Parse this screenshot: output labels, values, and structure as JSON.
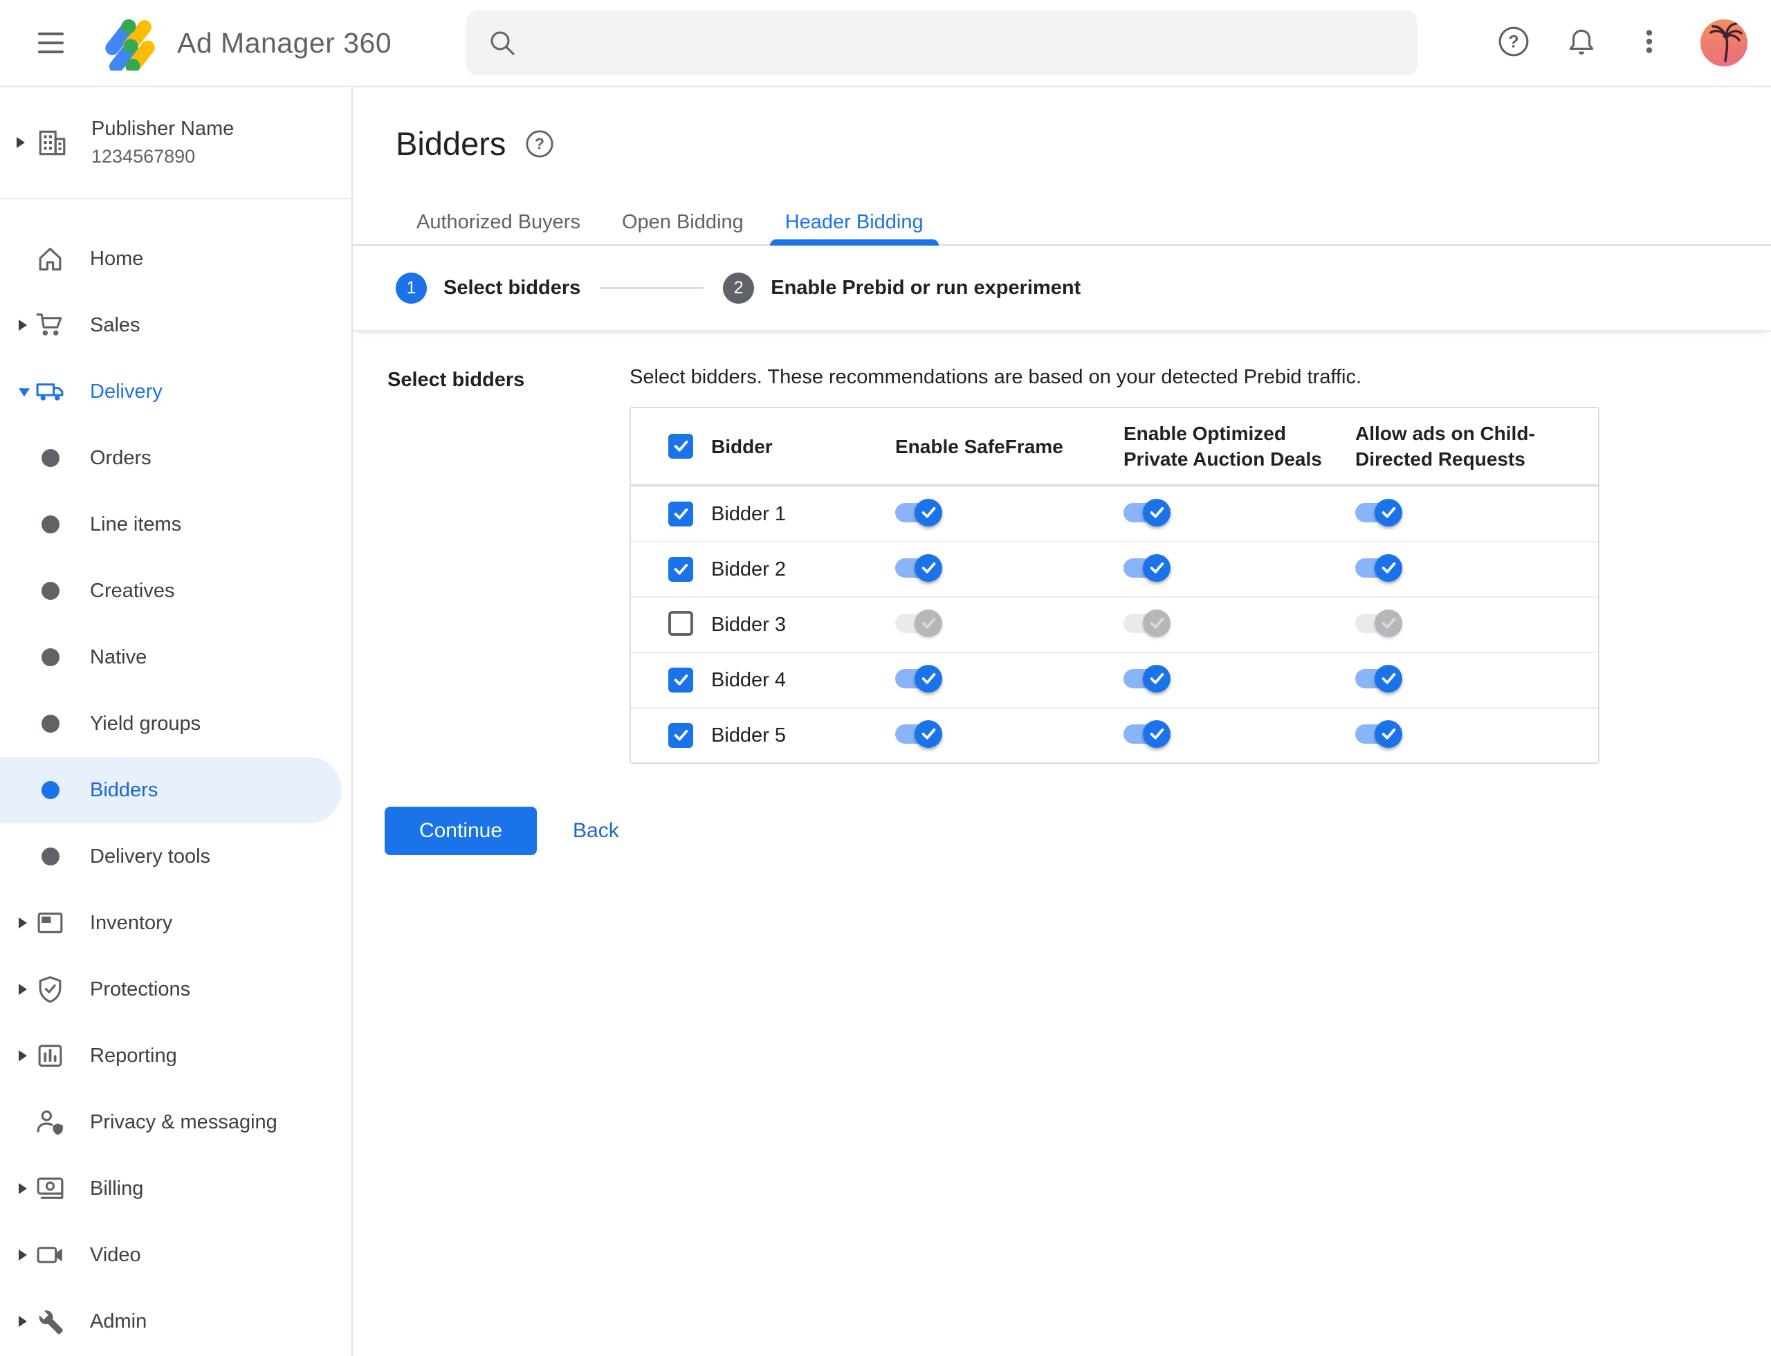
{
  "header": {
    "app_name": "Ad Manager 360",
    "search": {
      "placeholder": ""
    },
    "actions": [
      {
        "name": "help",
        "icon": "help-icon"
      },
      {
        "name": "notifications",
        "icon": "bell-icon"
      },
      {
        "name": "more",
        "icon": "more-vert-icon"
      },
      {
        "name": "account",
        "icon": "palm-avatar"
      }
    ]
  },
  "sidebar": {
    "publisher": {
      "name": "Publisher Name",
      "id": "1234567890"
    },
    "items": [
      {
        "label": "Home",
        "icon": "home",
        "caret": "none",
        "level": 0,
        "state": "normal"
      },
      {
        "label": "Sales",
        "icon": "cart",
        "caret": "right",
        "level": 0,
        "state": "normal"
      },
      {
        "label": "Delivery",
        "icon": "truck",
        "caret": "down",
        "level": 0,
        "state": "expanded"
      },
      {
        "label": "Orders",
        "icon": "bullet",
        "caret": "none",
        "level": 1,
        "state": "normal"
      },
      {
        "label": "Line items",
        "icon": "bullet",
        "caret": "none",
        "level": 1,
        "state": "normal"
      },
      {
        "label": "Creatives",
        "icon": "bullet",
        "caret": "none",
        "level": 1,
        "state": "normal"
      },
      {
        "label": "Native",
        "icon": "bullet",
        "caret": "none",
        "level": 1,
        "state": "normal"
      },
      {
        "label": "Yield groups",
        "icon": "bullet",
        "caret": "none",
        "level": 1,
        "state": "normal"
      },
      {
        "label": "Bidders",
        "icon": "bullet",
        "caret": "none",
        "level": 1,
        "state": "selected"
      },
      {
        "label": "Delivery tools",
        "icon": "bullet",
        "caret": "none",
        "level": 1,
        "state": "normal"
      },
      {
        "label": "Inventory",
        "icon": "inventory",
        "caret": "right",
        "level": 0,
        "state": "normal"
      },
      {
        "label": "Protections",
        "icon": "shield-check",
        "caret": "right",
        "level": 0,
        "state": "normal"
      },
      {
        "label": "Reporting",
        "icon": "bar-chart",
        "caret": "right",
        "level": 0,
        "state": "normal"
      },
      {
        "label": "Privacy & messaging",
        "icon": "person-shield",
        "caret": "none",
        "level": 0,
        "state": "normal"
      },
      {
        "label": "Billing",
        "icon": "money",
        "caret": "right",
        "level": 0,
        "state": "normal"
      },
      {
        "label": "Video",
        "icon": "videocam",
        "caret": "right",
        "level": 0,
        "state": "normal"
      },
      {
        "label": "Admin",
        "icon": "wrench",
        "caret": "right",
        "level": 0,
        "state": "normal"
      }
    ]
  },
  "main": {
    "title": "Bidders",
    "tabs": [
      {
        "label": "Authorized Buyers",
        "active": false
      },
      {
        "label": "Open Bidding",
        "active": false
      },
      {
        "label": "Header Bidding",
        "active": true
      }
    ],
    "stepper": [
      {
        "number": "1",
        "label": "Select bidders",
        "state": "active"
      },
      {
        "number": "2",
        "label": "Enable Prebid or run experiment",
        "state": "upcoming"
      }
    ],
    "section_label": "Select bidders",
    "description": "Select bidders. These recommendations are based on your detected Prebid traffic.",
    "table": {
      "select_all_checked": true,
      "columns": [
        "Bidder",
        "Enable SafeFrame",
        "Enable Optimized Private Auction Deals",
        "Allow ads on Child-Directed Requests"
      ],
      "rows": [
        {
          "name": "Bidder 1",
          "checked": true,
          "enable_safeframe": true,
          "enable_optimized_deals": true,
          "allow_child_directed": true
        },
        {
          "name": "Bidder 2",
          "checked": true,
          "enable_safeframe": true,
          "enable_optimized_deals": true,
          "allow_child_directed": true
        },
        {
          "name": "Bidder 3",
          "checked": false,
          "enable_safeframe": false,
          "enable_optimized_deals": false,
          "allow_child_directed": false
        },
        {
          "name": "Bidder 4",
          "checked": true,
          "enable_safeframe": true,
          "enable_optimized_deals": true,
          "allow_child_directed": true
        },
        {
          "name": "Bidder 5",
          "checked": true,
          "enable_safeframe": true,
          "enable_optimized_deals": true,
          "allow_child_directed": true
        }
      ]
    },
    "actions": {
      "continue_label": "Continue",
      "back_label": "Back"
    }
  },
  "colors": {
    "primary_blue": "#1a73e8",
    "link_blue": "#1967d2",
    "selected_pill": "#e8f0fe",
    "toggle_track_on": "#8ab4f8",
    "toggle_track_off": "#e8eaed",
    "toggle_thumb_off": "#b5b8bb",
    "text_primary": "#202124",
    "text_secondary": "#5f6368",
    "border": "#dadce0",
    "search_background": "#f1f3f4"
  }
}
